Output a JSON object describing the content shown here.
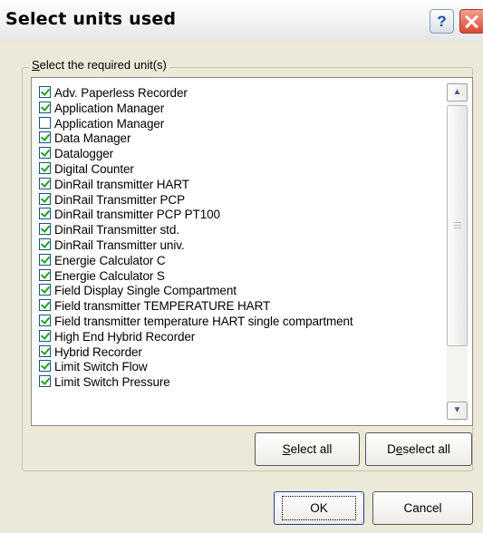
{
  "window": {
    "title": "Select units used",
    "help_label": "?"
  },
  "group": {
    "label_prefix": "S",
    "label_rest": "elect the required unit(s)"
  },
  "units": [
    {
      "label": "Adv. Paperless Recorder",
      "checked": true
    },
    {
      "label": "Application Manager",
      "checked": true
    },
    {
      "label": "Application Manager",
      "checked": false
    },
    {
      "label": "Data Manager",
      "checked": true
    },
    {
      "label": "Datalogger",
      "checked": true
    },
    {
      "label": "Digital Counter",
      "checked": true
    },
    {
      "label": "DinRail transmitter HART",
      "checked": true
    },
    {
      "label": "DinRail Transmitter PCP",
      "checked": true
    },
    {
      "label": "DinRail transmitter PCP PT100",
      "checked": true
    },
    {
      "label": "DinRail Transmitter std.",
      "checked": true
    },
    {
      "label": "DinRail Transmitter univ.",
      "checked": true
    },
    {
      "label": "Energie Calculator C",
      "checked": true
    },
    {
      "label": "Energie Calculator S",
      "checked": true
    },
    {
      "label": "Field Display Single Compartment",
      "checked": true
    },
    {
      "label": "Field transmitter TEMPERATURE HART",
      "checked": true
    },
    {
      "label": "Field transmitter temperature HART single compartment",
      "checked": true
    },
    {
      "label": "High End Hybrid Recorder",
      "checked": true
    },
    {
      "label": "Hybrid Recorder",
      "checked": true
    },
    {
      "label": "Limit Switch Flow",
      "checked": true
    },
    {
      "label": "Limit Switch Pressure",
      "checked": true
    }
  ],
  "buttons": {
    "select_all_prefix": "S",
    "select_all_rest": "elect all",
    "deselect_all_prefix": "D",
    "deselect_all_u": "e",
    "deselect_all_rest": "select all",
    "ok": "OK",
    "cancel": "Cancel"
  },
  "icons": {
    "scroll_up": "▲",
    "scroll_down": "▼"
  }
}
